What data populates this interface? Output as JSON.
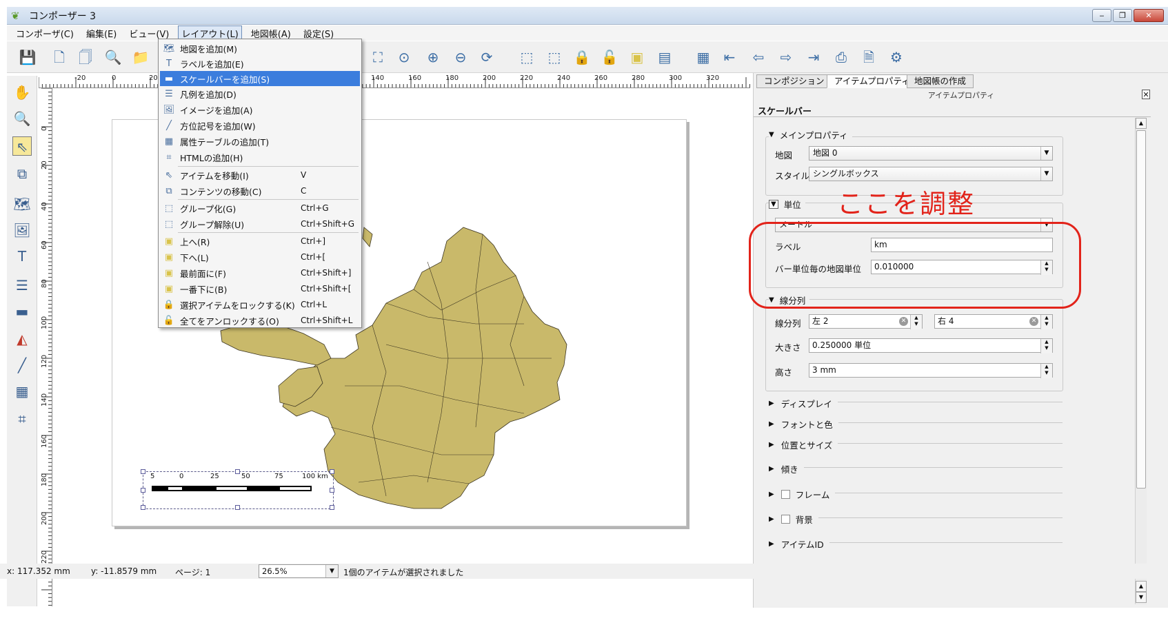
{
  "window": {
    "title": "コンポーザー 3",
    "buttons": {
      "minimize": "‒",
      "restore": "❐",
      "close": "✕"
    }
  },
  "menubar": {
    "items": [
      "コンポーザ(C)",
      "編集(E)",
      "ビュー(V)",
      "レイアウト(L)",
      "地図帳(A)",
      "設定(S)"
    ]
  },
  "layout_menu": {
    "items": [
      {
        "label": "地図を追加(M)",
        "shortcut": "",
        "icon": "add-map-icon"
      },
      {
        "label": "ラベルを追加(E)",
        "shortcut": "",
        "icon": "add-label-icon"
      },
      {
        "label": "スケールバーを追加(S)",
        "shortcut": "",
        "icon": "add-scalebar-icon"
      },
      {
        "label": "凡例を追加(D)",
        "shortcut": "",
        "icon": "add-legend-icon"
      },
      {
        "label": "イメージを追加(A)",
        "shortcut": "",
        "icon": "add-image-icon"
      },
      {
        "label": "方位記号を追加(W)",
        "shortcut": "",
        "icon": "add-arrow-icon"
      },
      {
        "label": "属性テーブルの追加(T)",
        "shortcut": "",
        "icon": "add-table-icon"
      },
      {
        "label": "HTMLの追加(H)",
        "shortcut": "",
        "icon": "add-html-icon"
      },
      {
        "label": "アイテムを移動(I)",
        "shortcut": "V",
        "icon": "select-move-icon"
      },
      {
        "label": "コンテンツの移動(C)",
        "shortcut": "C",
        "icon": "move-content-icon"
      },
      {
        "label": "グループ化(G)",
        "shortcut": "Ctrl+G",
        "icon": "group-icon"
      },
      {
        "label": "グループ解除(U)",
        "shortcut": "Ctrl+Shift+G",
        "icon": "ungroup-icon"
      },
      {
        "label": "上へ(R)",
        "shortcut": "Ctrl+]",
        "icon": "raise-icon"
      },
      {
        "label": "下へ(L)",
        "shortcut": "Ctrl+[",
        "icon": "lower-icon"
      },
      {
        "label": "最前面に(F)",
        "shortcut": "Ctrl+Shift+]",
        "icon": "bring-front-icon"
      },
      {
        "label": "一番下に(B)",
        "shortcut": "Ctrl+Shift+[",
        "icon": "send-back-icon"
      },
      {
        "label": "選択アイテムをロックする(K)",
        "shortcut": "Ctrl+L",
        "icon": "lock-icon"
      },
      {
        "label": "全てをアンロックする(O)",
        "shortcut": "Ctrl+Shift+L",
        "icon": "unlock-icon"
      }
    ],
    "highlighted_index": 2
  },
  "ruler": {
    "h_labels": [
      "-20",
      "0",
      "20",
      "140",
      "160",
      "180",
      "200",
      "220",
      "240",
      "260",
      "280",
      "300",
      "320"
    ],
    "v_labels": [
      "0",
      "20",
      "40",
      "60",
      "80",
      "100",
      "120",
      "140",
      "160",
      "180",
      "200",
      "220"
    ]
  },
  "scalebar": {
    "labels": [
      "5",
      "0",
      "25",
      "50",
      "75",
      "100 km"
    ]
  },
  "panel": {
    "tabs": [
      "コンポジション",
      "アイテムプロパティ",
      "地図帳の作成"
    ],
    "active_tab": "アイテムプロパティ",
    "dock_title": "アイテムプロパティ",
    "item_type": "スケールバー",
    "main_props": {
      "header": "メインプロパティ",
      "map_label": "地図",
      "map_value": "地図 0",
      "style_label": "スタイル",
      "style_value": "シングルボックス"
    },
    "units": {
      "header": "単位",
      "unit_value": "メートル",
      "label_label": "ラベル",
      "label_value": "km",
      "mapunits_label": "バー単位毎の地図単位",
      "mapunits_value": "0.010000"
    },
    "segments": {
      "header": "線分列",
      "segments_label": "線分列",
      "left_value": "左 2",
      "right_value": "右 4",
      "size_label": "大きさ",
      "size_value": "0.250000 単位",
      "height_label": "高さ",
      "height_value": "3 mm"
    },
    "collapsed_sections": [
      "ディスプレイ",
      "フォントと色",
      "位置とサイズ",
      "傾き",
      "フレーム",
      "背景",
      "アイテムID"
    ]
  },
  "annotation": {
    "text": "ここを調整",
    "color": "#e2231a"
  },
  "statusbar": {
    "x": "x: 117.352 mm",
    "y": "y: -11.8579 mm",
    "page": "ページ: 1",
    "zoom": "26.5%",
    "message": "1個のアイテムが選択されました"
  },
  "colors": {
    "map_fill": "#c9b96a",
    "highlight": "#3b7ddd"
  }
}
